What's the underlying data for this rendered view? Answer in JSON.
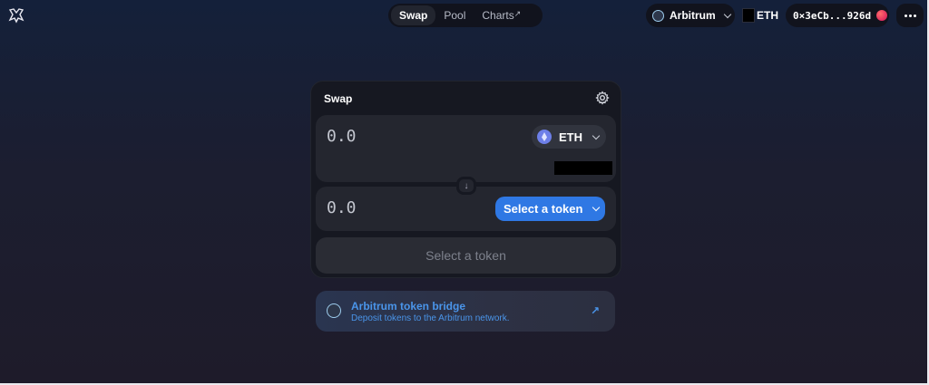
{
  "header": {
    "logo_icon": "uniswap-unicorn-icon",
    "nav_tabs": [
      {
        "label": "Swap",
        "active": true
      },
      {
        "label": "Pool",
        "active": false
      },
      {
        "label": "Charts",
        "active": false,
        "external_marker": "↗"
      }
    ],
    "network": {
      "label": "Arbitrum",
      "icon": "arbitrum-icon"
    },
    "balance_symbol": "ETH",
    "account_address": "0×3eCb...926d",
    "more_icon": "ellipsis-icon"
  },
  "swap": {
    "title": "Swap",
    "settings_icon": "gear-icon",
    "input": {
      "amount": "0.0",
      "token": "ETH",
      "token_icon": "eth-icon"
    },
    "output": {
      "amount": "0.0",
      "select_label": "Select a token"
    },
    "switch_icon": "arrow-down-icon",
    "action_label": "Select a token"
  },
  "bridge": {
    "title": "Arbitrum token bridge",
    "subtitle": "Deposit tokens to the Arbitrum network.",
    "arrow": "↗"
  },
  "colors": {
    "accent": "#2f78e4",
    "link": "#4a95ea",
    "card": "#161821",
    "panel": "#24262f"
  }
}
